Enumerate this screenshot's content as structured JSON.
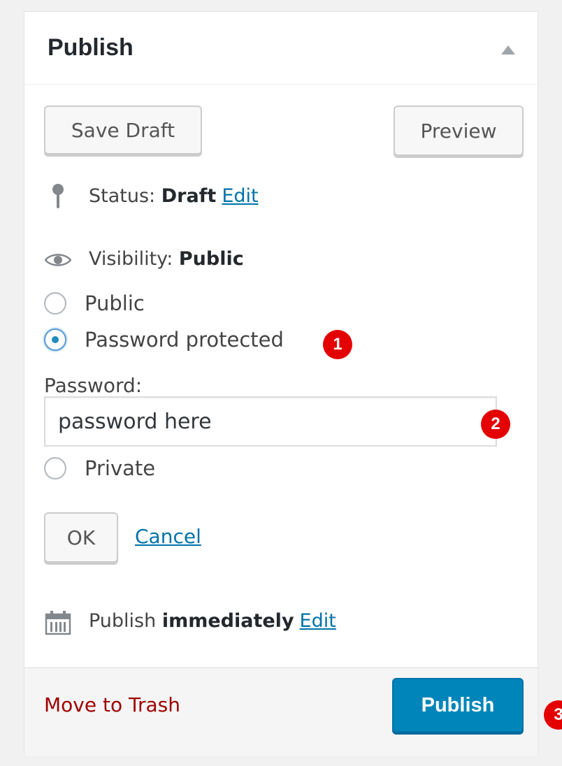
{
  "panel": {
    "title": "Publish"
  },
  "actions": {
    "save_draft_label": "Save Draft",
    "preview_label": "Preview"
  },
  "status": {
    "prefix": "Status: ",
    "value": "Draft",
    "edit_label": "Edit"
  },
  "visibility": {
    "prefix": "Visibility: ",
    "value": "Public",
    "options": [
      {
        "label": "Public",
        "checked": false
      },
      {
        "label": "Password protected",
        "checked": true
      },
      {
        "label": "Private",
        "checked": false
      }
    ],
    "password_label": "Password:",
    "password_value": "password here",
    "ok_label": "OK",
    "cancel_label": "Cancel"
  },
  "schedule": {
    "prefix": "Publish ",
    "value": "immediately",
    "edit_label": "Edit"
  },
  "major": {
    "trash_label": "Move to Trash",
    "publish_label": "Publish"
  },
  "badges": [
    "1",
    "2",
    "3"
  ],
  "colors": {
    "link": "#0073aa",
    "trash": "#a00000",
    "primary_button": "#0085ba",
    "badge": "#e40000"
  },
  "icons": {
    "status": "pin-icon",
    "visibility": "eye-icon",
    "schedule": "calendar-icon",
    "toggle": "triangle-up-icon"
  }
}
